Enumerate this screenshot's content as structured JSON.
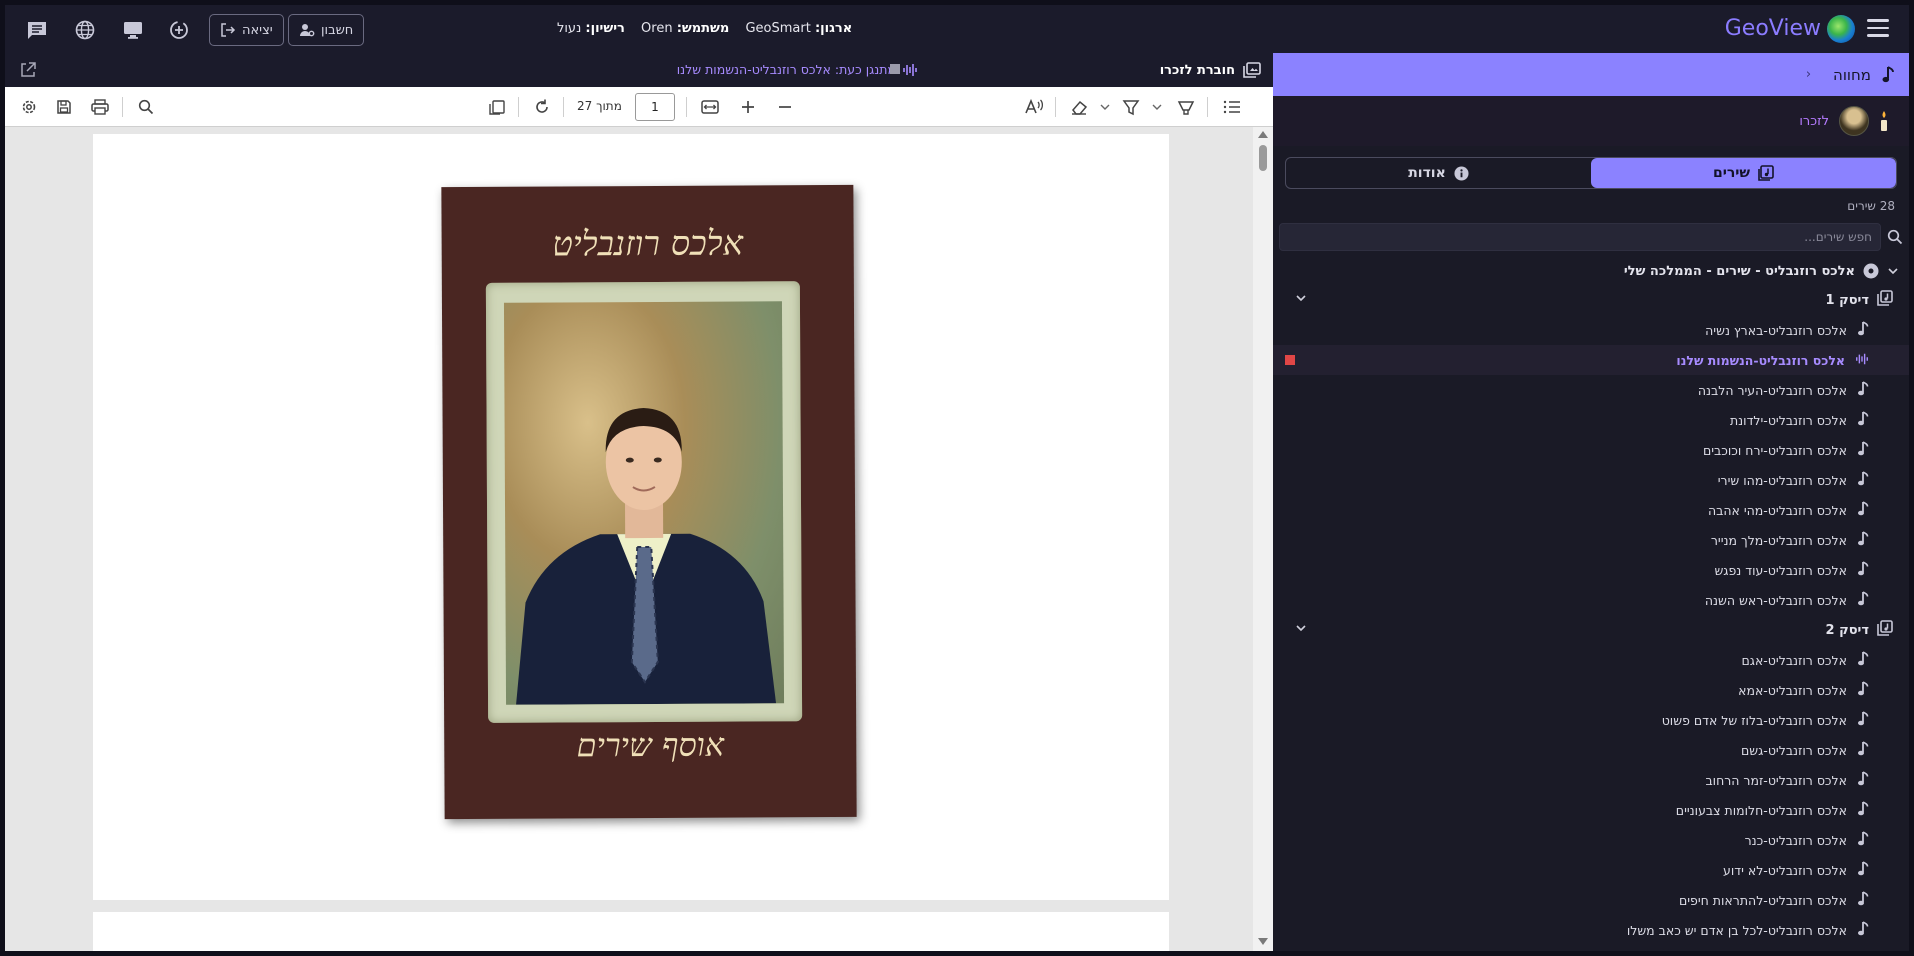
{
  "app": {
    "brand": "GeoView",
    "org_label": "ארגון:",
    "org_value": "GeoSmart",
    "user_label": "משתמש:",
    "user_value": "Oren",
    "license_label": "רישיון:",
    "license_value": "נעול",
    "account_button": "חשבון",
    "logout_button": "יציאה"
  },
  "sidebar": {
    "header_title": "מחווה",
    "memorial_label": "לזכרו",
    "tabs": [
      {
        "label": "שירים",
        "icon": "music-library-icon",
        "active": true
      },
      {
        "label": "אודות",
        "icon": "info-icon",
        "active": false
      }
    ],
    "song_count": "28 שירים",
    "search_placeholder": "חפש שירים...",
    "root_label": "אלכס רוזנבליט - שירים - הממלכה שלי",
    "discs": [
      {
        "label": "דיסק 1",
        "songs": [
          {
            "title": "אלכס רוזנבליט-בארץ נשיה",
            "playing": false
          },
          {
            "title": "אלכס רוזנבליט-הנשמות שלנו",
            "playing": true
          },
          {
            "title": "אלכס רוזנבליט-העיר הלבנה",
            "playing": false
          },
          {
            "title": "אלכס רוזנבליט-ילדונת",
            "playing": false
          },
          {
            "title": "אלכס רוזנבליט-ירח וכוכבים",
            "playing": false
          },
          {
            "title": "אלכס רוזנבליט-מהו שירי",
            "playing": false
          },
          {
            "title": "אלכס רוזנבליט-מהי אהבה",
            "playing": false
          },
          {
            "title": "אלכס רוזנבליט-מלך מנייר",
            "playing": false
          },
          {
            "title": "אלכס רוזנבליט-עוד נפגש",
            "playing": false
          },
          {
            "title": "אלכס רוזנבליט-ראש השנה",
            "playing": false
          }
        ]
      },
      {
        "label": "דיסק 2",
        "songs": [
          {
            "title": "אלכס רוזנבליט-אגם",
            "playing": false
          },
          {
            "title": "אלכס רוזנבליט-אמא",
            "playing": false
          },
          {
            "title": "אלכס רוזנבליט-בלוז של אדם פשוט",
            "playing": false
          },
          {
            "title": "אלכס רוזנבליט-גשם",
            "playing": false
          },
          {
            "title": "אלכס רוזנבליט-זמר הרחוב",
            "playing": false
          },
          {
            "title": "אלכס רוזנבליט-חלומות צבעוניים",
            "playing": false
          },
          {
            "title": "אלכס רוזנבליט-כנר",
            "playing": false
          },
          {
            "title": "אלכס רוזנבליט-לא ידוע",
            "playing": false
          },
          {
            "title": "אלכס רוזנבליט-להתראות חיפים",
            "playing": false
          },
          {
            "title": "אלכס רוזנבליט-לכל בן אדם יש כאב משלו",
            "playing": false
          }
        ]
      }
    ]
  },
  "viewer": {
    "doc_title": "חוברת לזכרו",
    "now_playing": "מתנגן כעת: אלכס רוזנבליט-הנשמות שלנו",
    "page_current": "1",
    "page_of_label": "מתוך 27",
    "cover_title": "אלכס רוזנבליט",
    "cover_subtitle": "אוסף שירים"
  },
  "colors": {
    "accent": "#8b82ff",
    "playing": "#a78bff",
    "stop": "#e04646",
    "cover": "#4a2622"
  }
}
